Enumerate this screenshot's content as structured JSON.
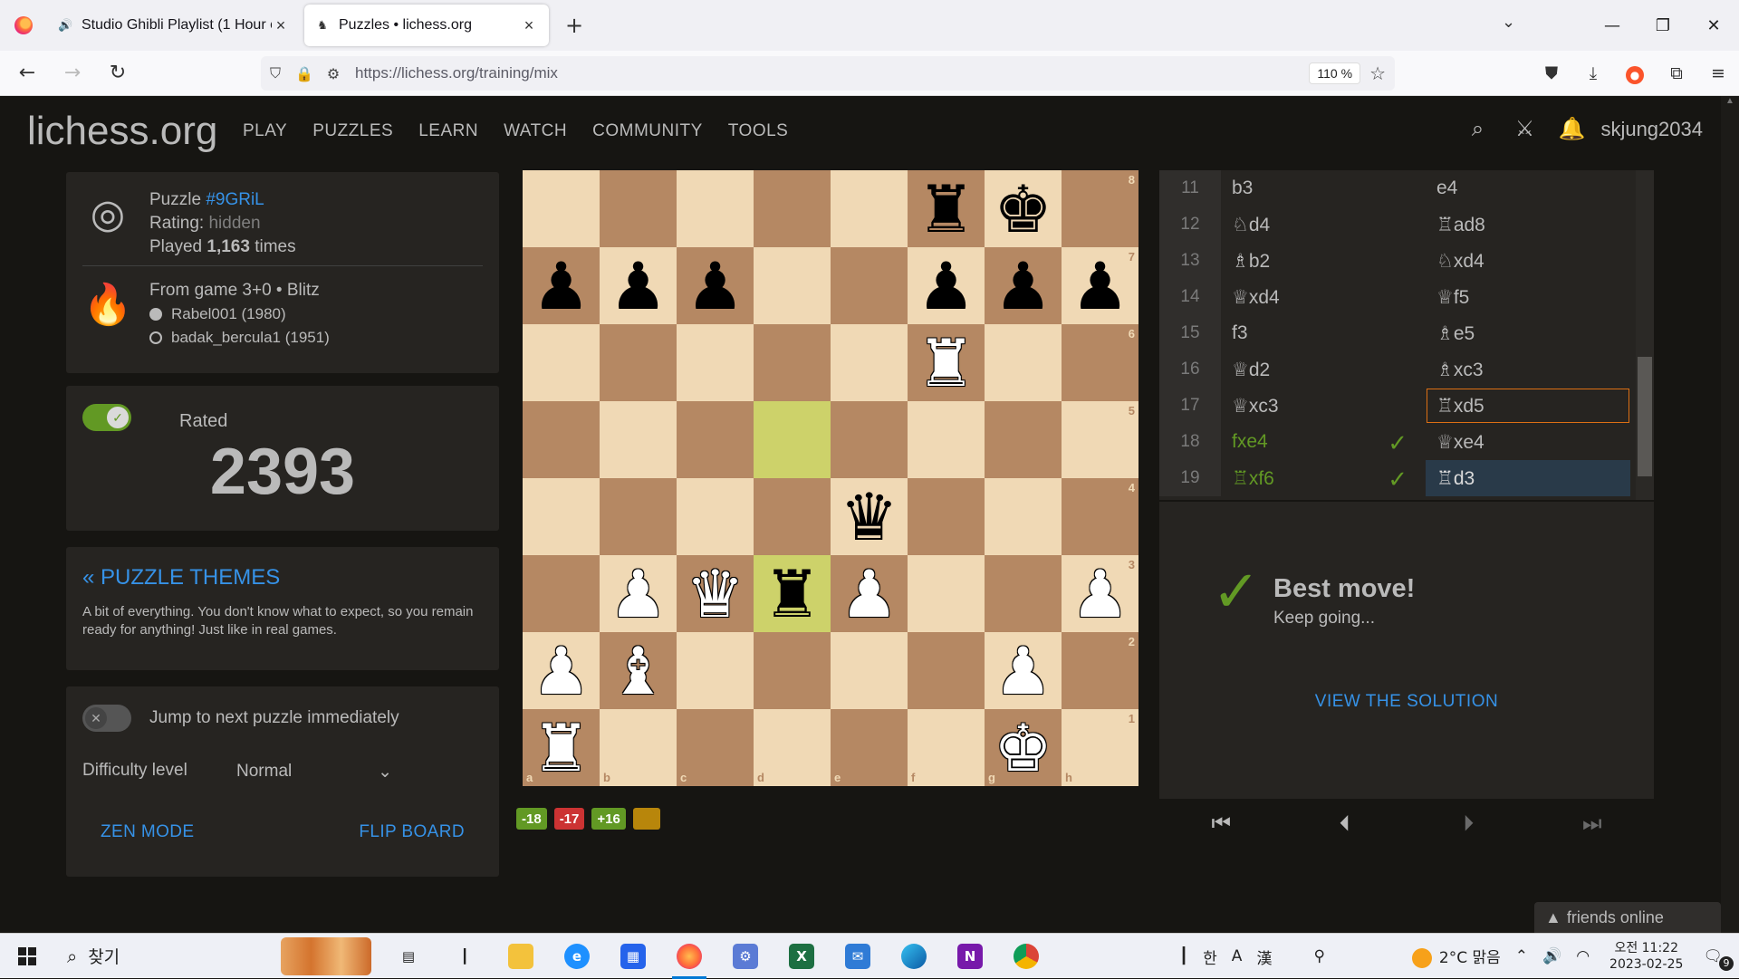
{
  "browser": {
    "tabs": [
      {
        "title": "Studio Ghibli Playlist (1 Hour of",
        "icon": "speaker-icon",
        "active": false
      },
      {
        "title": "Puzzles • lichess.org",
        "icon": "lichess-icon",
        "active": true
      }
    ],
    "url": "https://lichess.org/training/mix",
    "zoom": "110 %"
  },
  "site": {
    "logo_name": "lichess",
    "logo_tld": ".org",
    "nav": [
      "PLAY",
      "PUZZLES",
      "LEARN",
      "WATCH",
      "COMMUNITY",
      "TOOLS"
    ],
    "username": "skjung2034"
  },
  "puzzle": {
    "label": "Puzzle",
    "id": "#9GRiL",
    "rating_label": "Rating:",
    "rating_value": "hidden",
    "played_prefix": "Played",
    "played_count": "1,163",
    "played_suffix": "times",
    "game_text": "From game 3+0 • Blitz",
    "white_player": "Rabel001 (1980)",
    "black_player": "badak_bercula1 (1951)"
  },
  "rated": {
    "label": "Rated",
    "rating": "2393"
  },
  "themes": {
    "title": "« PUZZLE THEMES",
    "description": "A bit of everything. You don't know what to expect, so you remain ready for anything! Just like in real games."
  },
  "settings": {
    "jump_label": "Jump to next puzzle immediately",
    "difficulty_label": "Difficulty level",
    "difficulty_value": "Normal",
    "zen_mode": "ZEN MODE",
    "flip_board": "FLIP BOARD"
  },
  "board": {
    "files": [
      "a",
      "b",
      "c",
      "d",
      "e",
      "f",
      "g",
      "h"
    ],
    "ranks": [
      "8",
      "7",
      "6",
      "5",
      "4",
      "3",
      "2",
      "1"
    ],
    "highlight": [
      "d5",
      "d3"
    ],
    "pieces": {
      "f8": "bR",
      "g8": "bK",
      "a7": "bP",
      "b7": "bP",
      "c7": "bP",
      "f7": "bP",
      "g7": "bP",
      "h7": "bP",
      "f6": "wR",
      "e4": "bQ",
      "b3": "wP",
      "c3": "wQ",
      "d3": "bR",
      "e3": "wP",
      "h3": "wP",
      "a2": "wP",
      "b2": "wB",
      "g2": "wP",
      "a1": "wR",
      "g1": "wK"
    }
  },
  "badges": [
    {
      "text": "-18",
      "color": "#629924"
    },
    {
      "text": "-17",
      "color": "#cc3333"
    },
    {
      "text": "+16",
      "color": "#629924"
    },
    {
      "text": "",
      "color": "#b8860b"
    }
  ],
  "moves": [
    {
      "num": "11",
      "white": "b3",
      "black": "e4"
    },
    {
      "num": "12",
      "white": "♘d4",
      "black": "♖ad8"
    },
    {
      "num": "13",
      "white": "♗b2",
      "black": "♘xd4"
    },
    {
      "num": "14",
      "white": "♕xd4",
      "black": "♕f5"
    },
    {
      "num": "15",
      "white": "f3",
      "black": "♗e5"
    },
    {
      "num": "16",
      "white": "♕d2",
      "black": "♗xc3"
    },
    {
      "num": "17",
      "white": "♕xc3",
      "black": "♖xd5"
    },
    {
      "num": "18",
      "white": "fxe4",
      "black": "♕xe4"
    },
    {
      "num": "19",
      "white": "♖xf6",
      "black": "♖d3"
    }
  ],
  "feedback": {
    "title": "Best move!",
    "subtitle": "Keep going...",
    "solution": "VIEW THE SOLUTION"
  },
  "friends": "friends online",
  "taskbar": {
    "search": "찾기",
    "weather": "2°C  맑음",
    "time": "오전 11:22",
    "date": "2023-02-25",
    "notifications": "9",
    "ime": "한"
  }
}
